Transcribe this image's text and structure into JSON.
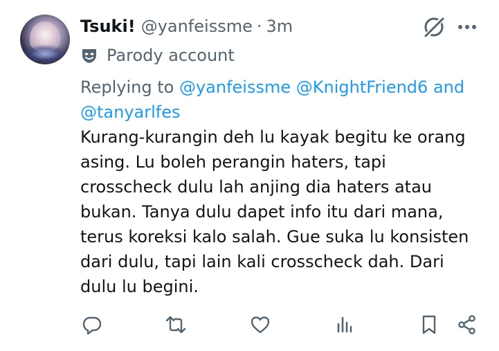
{
  "author": {
    "display_name": "Tsuki!",
    "handle": "@yanfeissme",
    "separator": "·",
    "time": "3m",
    "parody_label": "Parody account"
  },
  "reply": {
    "prefix": "Replying to",
    "mentions": [
      "@yanfeissme",
      "@KnightFriend6",
      "@tanyarlfes"
    ],
    "and_word": "and"
  },
  "post": {
    "lines": [
      "Kurang-kurangin deh lu kayak begitu ke orang",
      "asing. Lu boleh perangin haters, tapi",
      "crosscheck dulu lah anjing dia haters atau",
      "bukan. Tanya dulu dapet info itu dari mana,",
      "terus koreksi kalo salah. Gue suka lu konsisten",
      "dari dulu, tapi lain kali crosscheck dah. Dari",
      "dulu lu begini."
    ]
  },
  "icons": {
    "grok": "grok-icon",
    "more": "more-icon",
    "parody": "parody-mask-icon",
    "reply": "reply-icon",
    "repost": "repost-icon",
    "like": "like-icon",
    "views": "views-icon",
    "bookmark": "bookmark-icon",
    "share": "share-icon"
  },
  "colors": {
    "text": "#0f1419",
    "secondary": "#536471",
    "link": "#1d9bf0"
  }
}
